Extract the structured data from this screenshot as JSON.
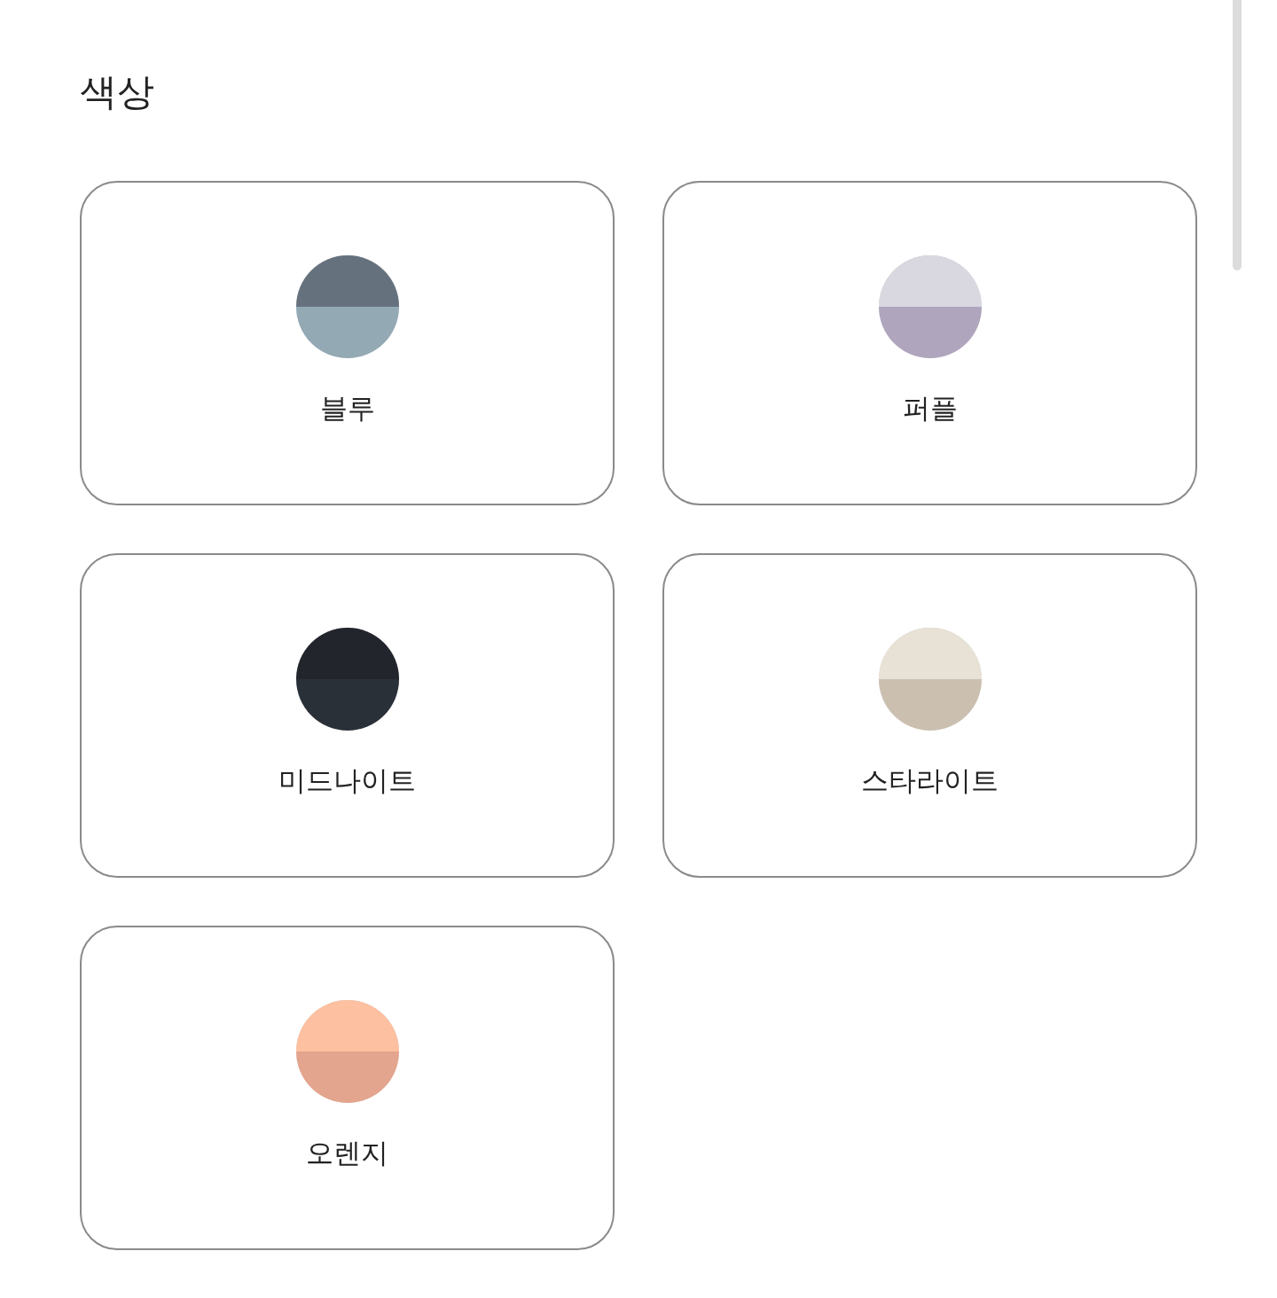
{
  "title": "색상",
  "colors": [
    {
      "label": "블루",
      "halves": [
        {
          "color": "#65727e"
        },
        {
          "color": "#93a9b4"
        }
      ]
    },
    {
      "label": "퍼플",
      "halves": [
        {
          "color": "#d9d7e0"
        },
        {
          "color": "#afa5bd"
        }
      ]
    },
    {
      "label": "미드나이트",
      "halves": [
        {
          "color": "#22252c"
        },
        {
          "color": "#2a3038"
        }
      ]
    },
    {
      "label": "스타라이트",
      "halves": [
        {
          "color": "#e8e1d6"
        },
        {
          "color": "#cbbfb0"
        }
      ]
    },
    {
      "label": "오렌지",
      "halves": [
        {
          "color": "#fdc0a0"
        },
        {
          "color": "#e3a58e"
        }
      ]
    }
  ]
}
